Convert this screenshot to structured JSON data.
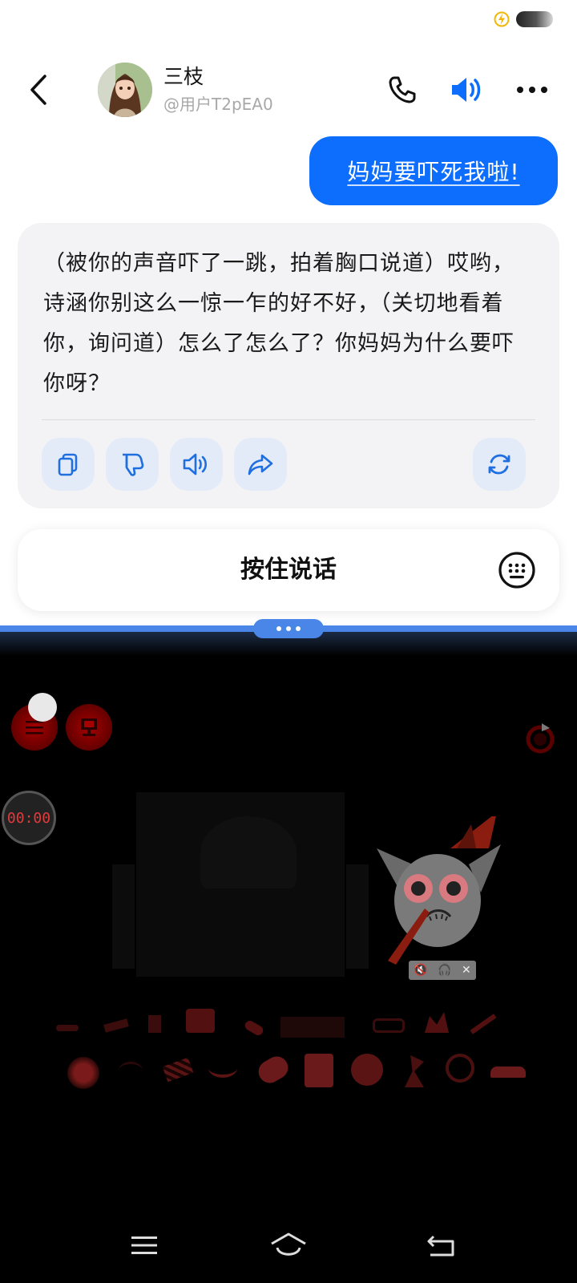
{
  "contact": {
    "name": "三枝",
    "handle": "@用户T2pEA0"
  },
  "messages": {
    "user": "妈妈要吓死我啦!",
    "ai": "（被你的声音吓了一跳，拍着胸口说道）哎哟，诗涵你别这么一惊一乍的好不好，（关切地看着你，询问道）怎么了怎么了？你妈妈为什么要吓你呀？"
  },
  "ai_actions": [
    "copy-icon",
    "dislike-icon",
    "play-audio-icon",
    "share-icon",
    "regenerate-icon"
  ],
  "input": {
    "talk_label": "按住说话"
  },
  "game": {
    "timer": "00:00",
    "pip_controls": [
      "mute-icon",
      "headphones-icon",
      "close-icon"
    ]
  },
  "colors": {
    "accent": "#0d6efd",
    "bubble_bg": "#f3f3f5",
    "game_red": "#a50000",
    "timer_text": "#e13b3b"
  },
  "nav": [
    "menu-icon",
    "home-icon",
    "back-icon"
  ]
}
